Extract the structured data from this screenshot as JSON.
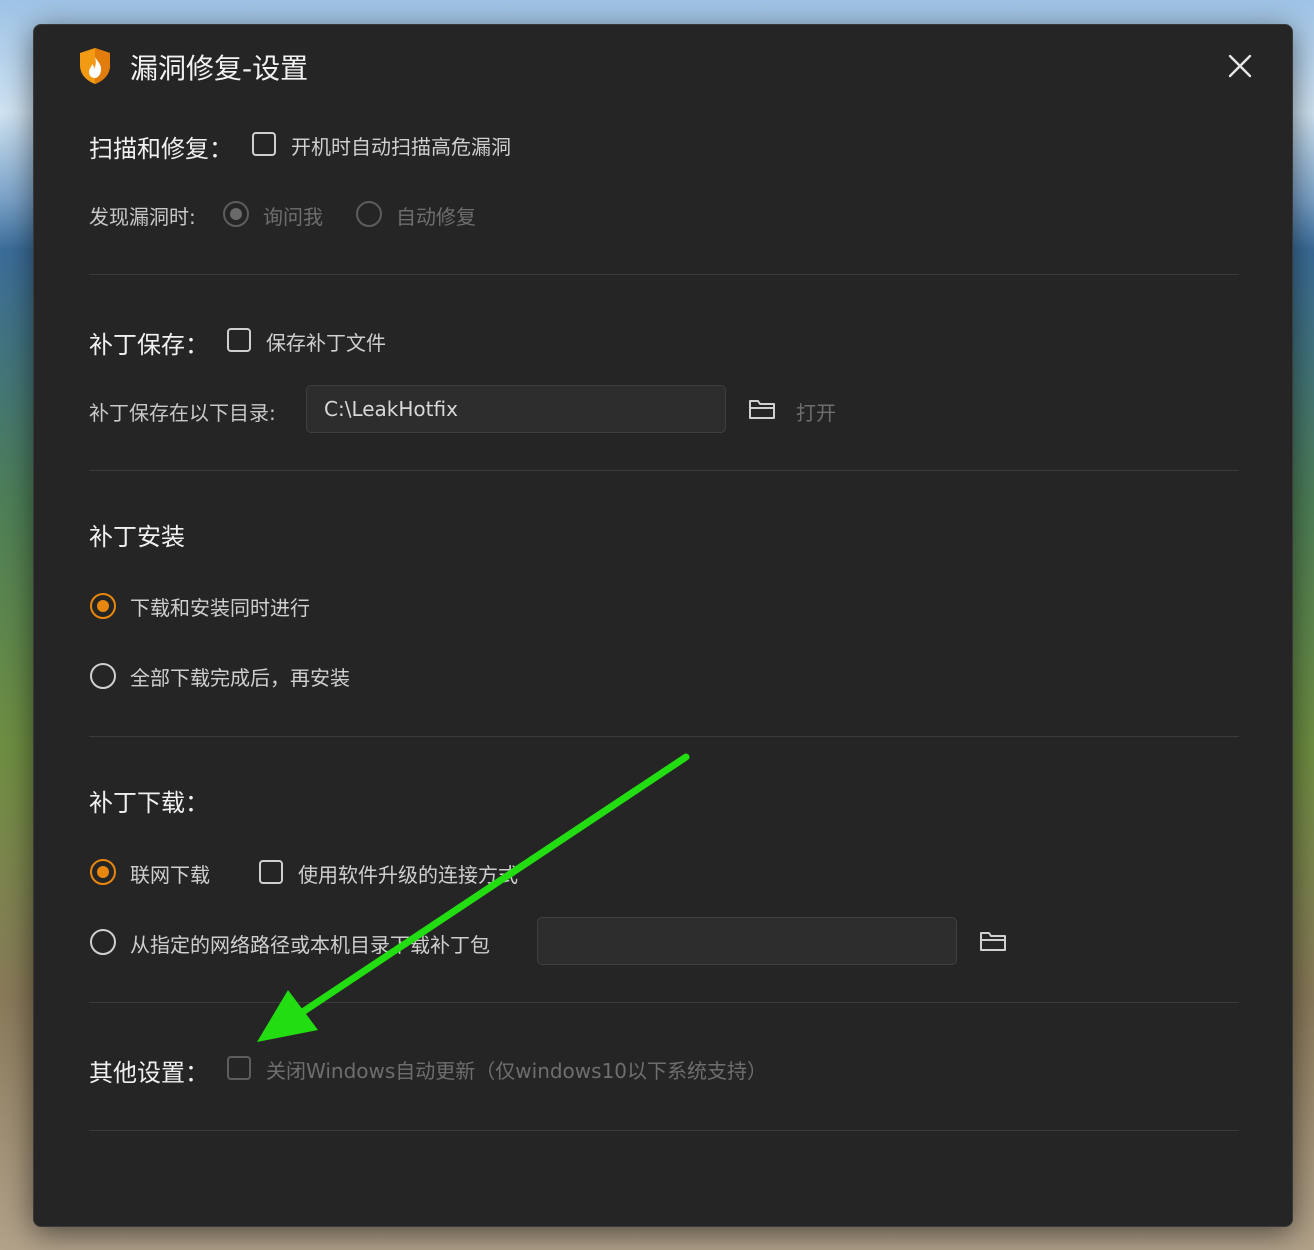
{
  "window": {
    "title": "漏洞修复-设置"
  },
  "scan": {
    "label": "扫描和修复：",
    "auto_scan_text": "开机时自动扫描高危漏洞",
    "on_found_label": "发现漏洞时:",
    "ask_me": "询问我",
    "auto_fix": "自动修复"
  },
  "patch_save": {
    "label": "补丁保存：",
    "save_files_text": "保存补丁文件",
    "dir_label": "补丁保存在以下目录:",
    "dir_value": "C:\\LeakHotfix",
    "open_label": "打开"
  },
  "patch_install": {
    "label": "补丁安装",
    "option_simultaneous": "下载和安装同时进行",
    "option_after_all": "全部下载完成后，再安装"
  },
  "patch_download": {
    "label": "补丁下载：",
    "online_download": "联网下载",
    "use_upgrade_connection": "使用软件升级的连接方式",
    "from_path": "从指定的网络路径或本机目录下载补丁包",
    "path_value": ""
  },
  "other": {
    "label": "其他设置：",
    "disable_windows_update": "关闭Windows自动更新（仅windows10以下系统支持）"
  },
  "colors": {
    "accent": "#e8870e",
    "dialog_bg": "#252525",
    "annotation_arrow": "#22dd11"
  }
}
